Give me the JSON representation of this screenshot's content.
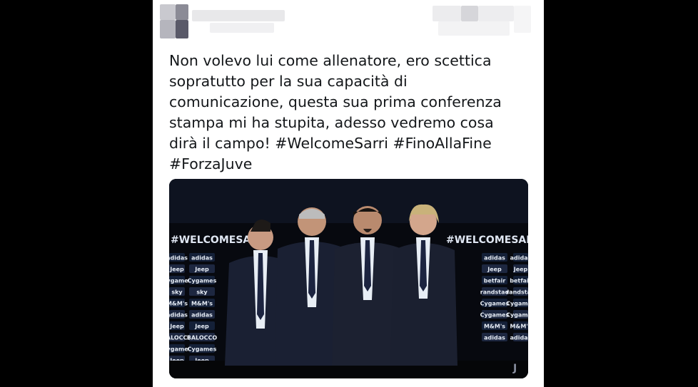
{
  "tweet": {
    "text_lines": [
      "Non volevo lui come allenatore, ero scettica",
      "sopratutto per la sua capacità di",
      "comunicazione, questa sua prima conferenza",
      "stampa mi ha stupita, adesso vedremo cosa",
      "dirà il campo! #WelcomeSarri #FinoAllaFine",
      "#ForzaJuve"
    ]
  },
  "photo": {
    "backdrop_title": "#WELCOMESARRI",
    "sponsors_left": [
      "adidas",
      "Jeep",
      "Cygames",
      "sky",
      "M&M's",
      "adidas",
      "Jeep",
      "BALOCCO",
      "Cygames",
      "Jeep"
    ],
    "sponsors_right": [
      "adidas",
      "Jeep",
      "betfair",
      "randstad",
      "Cygames",
      "Cygames",
      "M&M's",
      "adidas"
    ],
    "colors": {
      "backdrop": "#0a0d16",
      "suit": "#1a2033",
      "shirt": "#e8eef5",
      "tie": "#1c2440"
    }
  }
}
